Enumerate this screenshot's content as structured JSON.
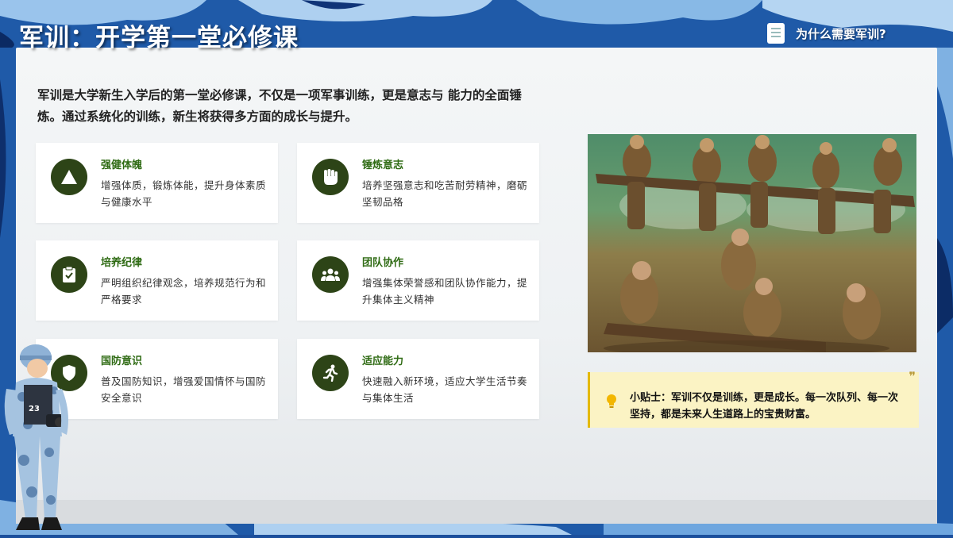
{
  "header": {
    "title": "军训：开学第一堂必修课",
    "why_link": "为什么需要军训?"
  },
  "intro": "军训是大学新生入学后的第一堂必修课，不仅是一项军事训练，更是意志与 能力的全面锤炼。通过系统化的训练，新生将获得多方面的成长与提升。",
  "cards": [
    {
      "title": "强健体魄",
      "desc": "增强体质，锻炼体能，提升身体素质与健康水平",
      "icon": "triangle-icon"
    },
    {
      "title": "锤炼意志",
      "desc": "培养坚强意志和吃苦耐劳精神，磨砺坚韧品格",
      "icon": "fist-icon"
    },
    {
      "title": "培养纪律",
      "desc": "严明组织纪律观念，培养规范行为和严格要求",
      "icon": "clipboard-check-icon"
    },
    {
      "title": "团队协作",
      "desc": "增强集体荣誉感和团队协作能力，提升集体主义精神",
      "icon": "team-icon"
    },
    {
      "title": "国防意识",
      "desc": "普及国防知识，增强爱国情怀与国防安全意识",
      "icon": "shield-icon"
    },
    {
      "title": "适应能力",
      "desc": "快速融入新环境，适应大学生活节奏与集体生活",
      "icon": "running-person-icon"
    }
  ],
  "tip": {
    "label": "小贴士：",
    "text": "军训不仅是训练，更是成长。每一次队列、每一次坚持，都是未来人生道路上的宝贵财富。"
  },
  "colors": {
    "camo_dark": "#1b4f9c",
    "camo_light": "#8fbde8",
    "icon_bg": "#2d4417",
    "card_title": "#2f6b14",
    "tip_bg": "#fbf3c4",
    "tip_border": "#e4b900"
  }
}
